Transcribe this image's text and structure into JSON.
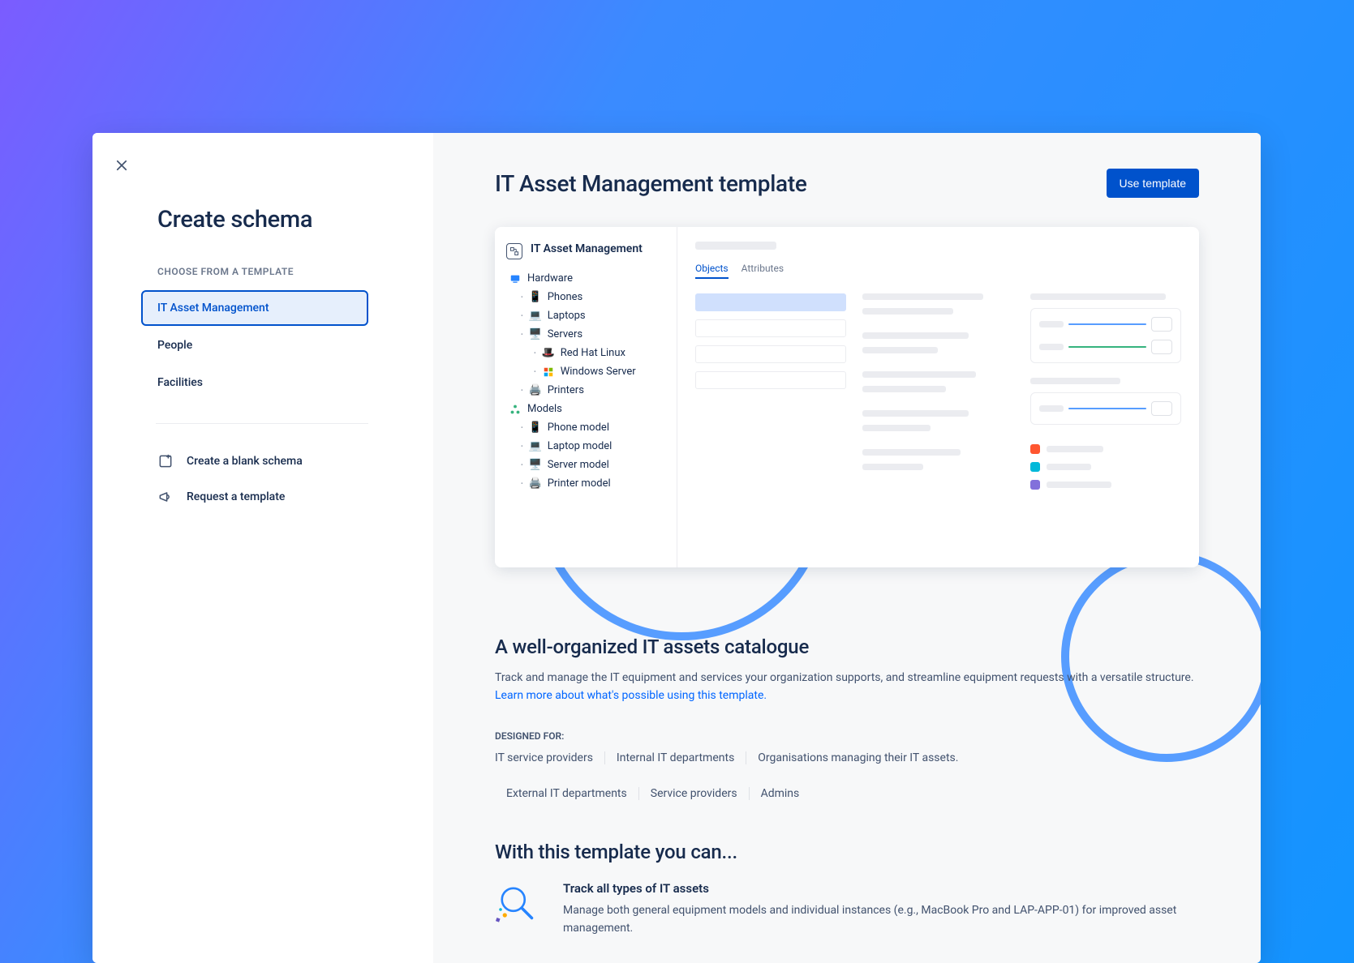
{
  "sidebar": {
    "title": "Create schema",
    "section_label": "CHOOSE FROM A TEMPLATE",
    "templates": [
      {
        "label": "IT Asset Management",
        "selected": true
      },
      {
        "label": "People",
        "selected": false
      },
      {
        "label": "Facilities",
        "selected": false
      }
    ],
    "actions": {
      "blank": "Create a blank schema",
      "request": "Request a template"
    }
  },
  "main": {
    "title": "IT Asset Management template",
    "use_button": "Use template",
    "preview": {
      "schema_name": "IT Asset Management",
      "tabs": {
        "objects": "Objects",
        "attributes": "Attributes"
      },
      "tree": {
        "hardware": "Hardware",
        "phones": "Phones",
        "laptops": "Laptops",
        "servers": "Servers",
        "redhat": "Red Hat Linux",
        "windows": "Windows Server",
        "printers": "Printers",
        "models": "Models",
        "phone_model": "Phone model",
        "laptop_model": "Laptop model",
        "server_model": "Server model",
        "printer_model": "Printer model"
      }
    },
    "catalogue": {
      "title": "A well-organized IT assets catalogue",
      "text": "Track and manage the IT equipment and services your organization supports, and streamline equipment requests with a versatile structure. ",
      "link": "Learn more about what's possible using this template."
    },
    "designed_label": "DESIGNED FOR:",
    "designed_for": [
      "IT service providers",
      "Internal IT departments",
      "Organisations managing their IT assets.",
      "External IT departments",
      "Service providers",
      "Admins"
    ],
    "with_title": "With this template you can...",
    "feature": {
      "title": "Track all types of IT assets",
      "text": "Manage both general equipment models and individual instances (e.g., MacBook Pro and LAP-APP-01) for improved asset management."
    }
  }
}
